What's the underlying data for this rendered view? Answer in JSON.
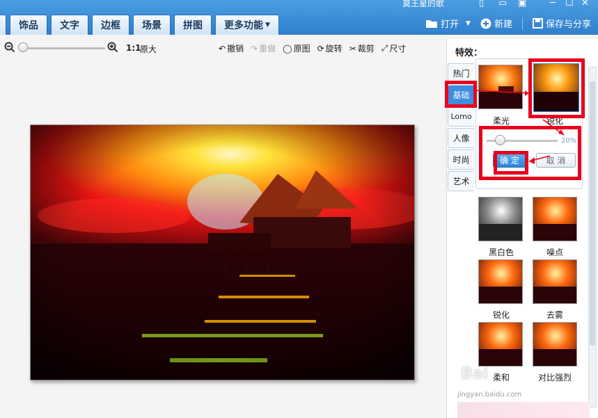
{
  "window": {
    "title": "莫王星的歌"
  },
  "nav": {
    "tabs": [
      "饰品",
      "文字",
      "边框",
      "场景",
      "拼图",
      "更多功能"
    ]
  },
  "header_actions": {
    "open": "打开",
    "new": "新建",
    "save_share": "保存与分享"
  },
  "toolbar": {
    "ratio": "1:1",
    "ratio_label": "原大",
    "undo": "撤销",
    "redo": "重做",
    "original": "原图",
    "rotate": "旋转",
    "crop": "裁剪",
    "size": "尺寸"
  },
  "effects": {
    "title": "特效：",
    "tabs": [
      "热门",
      "基础",
      "Lomo",
      "人像",
      "时尚",
      "艺术"
    ],
    "selected_tab": "基础",
    "top_thumbs": [
      {
        "label": "柔光"
      },
      {
        "label": "锐化"
      }
    ],
    "intensity": "20%",
    "confirm": "确 定",
    "cancel": "取 消",
    "list": [
      "黑白色",
      "噪点",
      "锐化",
      "去雾",
      "柔和",
      "对比强烈"
    ]
  },
  "watermark": {
    "text": "Bai",
    "sub": "jingyan.baidu.com"
  },
  "colors": {
    "accent": "#3d8de0",
    "highlight": "#e8001c",
    "topbar": "#2f7fcc"
  }
}
